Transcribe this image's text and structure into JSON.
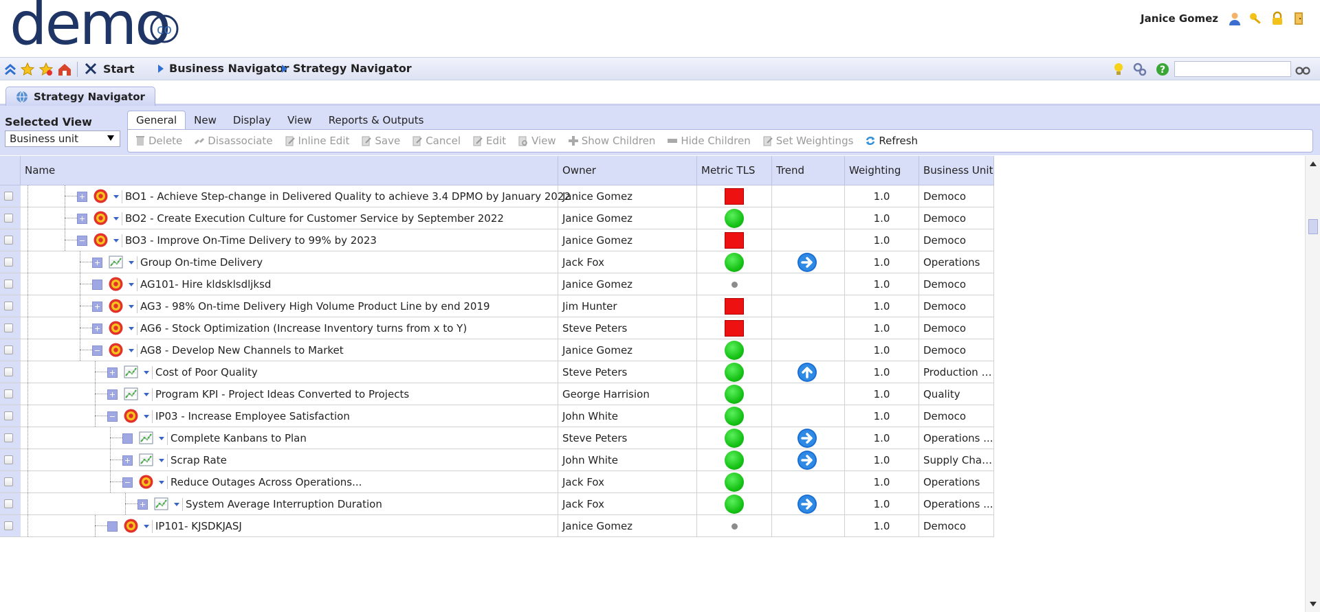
{
  "header": {
    "logo_text": "demo",
    "logo_badge": "co",
    "user_name": "Janice Gomez"
  },
  "nav": {
    "crumbs": [
      "Start",
      "Business Navigator",
      "Strategy Navigator"
    ],
    "search_value": ""
  },
  "tab": {
    "title": "Strategy Navigator"
  },
  "panel": {
    "selected_view_label": "Selected View",
    "selected_view_value": "Business unit",
    "tabs": [
      "General",
      "New",
      "Display",
      "View",
      "Reports & Outputs"
    ],
    "actions": [
      {
        "label": "Delete",
        "icon": "delete-icon",
        "enabled": false
      },
      {
        "label": "Disassociate",
        "icon": "disassociate-icon",
        "enabled": false
      },
      {
        "label": "Inline Edit",
        "icon": "inline-edit-icon",
        "enabled": false
      },
      {
        "label": "Save",
        "icon": "save-icon",
        "enabled": false
      },
      {
        "label": "Cancel",
        "icon": "cancel-icon",
        "enabled": false
      },
      {
        "label": "Edit",
        "icon": "edit-icon",
        "enabled": false
      },
      {
        "label": "View",
        "icon": "view-icon",
        "enabled": false
      },
      {
        "label": "Show Children",
        "icon": "show-children-icon",
        "enabled": false
      },
      {
        "label": "Hide Children",
        "icon": "hide-children-icon",
        "enabled": false
      },
      {
        "label": "Set Weightings",
        "icon": "set-weightings-icon",
        "enabled": false
      },
      {
        "label": "Refresh",
        "icon": "refresh-icon",
        "enabled": true
      }
    ]
  },
  "grid": {
    "columns": [
      "Name",
      "Owner",
      "Metric TLS",
      "Trend",
      "Weighting",
      "Business Unit"
    ],
    "rows": [
      {
        "depth": 0,
        "expander": "plus",
        "icon": "target-icon",
        "name": "BO1 - Achieve Step-change in Delivered Quality to achieve 3.4 DPMO by January 2022",
        "owner": "Janice Gomez",
        "tls": "red-square",
        "trend": "",
        "weighting": "1.0",
        "unit": "Democo"
      },
      {
        "depth": 0,
        "expander": "plus",
        "icon": "target-icon",
        "name": "BO2 - Create Execution Culture for Customer Service by September 2022",
        "owner": "Janice Gomez",
        "tls": "green-circle",
        "trend": "",
        "weighting": "1.0",
        "unit": "Democo"
      },
      {
        "depth": 0,
        "expander": "minus",
        "icon": "target-icon",
        "name": "BO3 - Improve On-Time Delivery to 99% by 2023",
        "owner": "Janice Gomez",
        "tls": "red-square",
        "trend": "",
        "weighting": "1.0",
        "unit": "Democo"
      },
      {
        "depth": 1,
        "expander": "plus",
        "icon": "chart-icon",
        "name": "Group On-time Delivery",
        "owner": "Jack Fox",
        "tls": "green-circle",
        "trend": "right",
        "weighting": "1.0",
        "unit": "Operations"
      },
      {
        "depth": 1,
        "expander": "leaf",
        "icon": "target-icon",
        "name": "AG101- Hire kldsklsdljksd",
        "owner": "Janice Gomez",
        "tls": "grey-dot",
        "trend": "",
        "weighting": "1.0",
        "unit": "Democo"
      },
      {
        "depth": 1,
        "expander": "plus",
        "icon": "target-icon",
        "name": "AG3 - 98% On-time Delivery High Volume Product Line by end 2019",
        "owner": "Jim Hunter",
        "tls": "red-square",
        "trend": "",
        "weighting": "1.0",
        "unit": "Democo"
      },
      {
        "depth": 1,
        "expander": "plus",
        "icon": "target-icon",
        "name": "AG6 - Stock Optimization (Increase Inventory turns from x to Y)",
        "owner": "Steve Peters",
        "tls": "red-square",
        "trend": "",
        "weighting": "1.0",
        "unit": "Democo"
      },
      {
        "depth": 1,
        "expander": "minus",
        "icon": "target-icon",
        "name": "AG8 - Develop New Channels to Market",
        "owner": "Janice Gomez",
        "tls": "green-circle",
        "trend": "",
        "weighting": "1.0",
        "unit": "Democo"
      },
      {
        "depth": 2,
        "expander": "plus",
        "icon": "chart-icon",
        "name": "Cost of Poor Quality",
        "owner": "Steve Peters",
        "tls": "green-circle",
        "trend": "up",
        "weighting": "1.0",
        "unit": "Production S..."
      },
      {
        "depth": 2,
        "expander": "plus",
        "icon": "chart-icon",
        "name": "Program KPI - Project Ideas Converted to Projects",
        "owner": "George Harrision",
        "tls": "green-circle",
        "trend": "",
        "weighting": "1.0",
        "unit": "Quality"
      },
      {
        "depth": 2,
        "expander": "minus",
        "icon": "target-icon",
        "name": "IP03 - Increase Employee Satisfaction",
        "owner": "John White",
        "tls": "green-circle",
        "trend": "",
        "weighting": "1.0",
        "unit": "Democo"
      },
      {
        "depth": 3,
        "expander": "leaf",
        "icon": "chart-icon",
        "name": "Complete Kanbans to Plan",
        "owner": "Steve Peters",
        "tls": "green-circle",
        "trend": "right",
        "weighting": "1.0",
        "unit": "Operations ..."
      },
      {
        "depth": 3,
        "expander": "plus",
        "icon": "chart-icon",
        "name": "Scrap Rate",
        "owner": "John White",
        "tls": "green-circle",
        "trend": "right",
        "weighting": "1.0",
        "unit": "Supply Chai..."
      },
      {
        "depth": 3,
        "expander": "minus",
        "icon": "target-icon",
        "name": "Reduce Outages Across Operations...",
        "owner": "Jack Fox",
        "tls": "green-circle",
        "trend": "",
        "weighting": "1.0",
        "unit": "Operations"
      },
      {
        "depth": 4,
        "expander": "plus",
        "icon": "chart-icon",
        "name": "System Average Interruption Duration",
        "owner": "Jack Fox",
        "tls": "green-circle",
        "trend": "right",
        "weighting": "1.0",
        "unit": "Operations ..."
      },
      {
        "depth": 2,
        "expander": "leaf",
        "icon": "target-icon",
        "name": "IP101- KJSDKJASJ",
        "owner": "Janice Gomez",
        "tls": "grey-dot",
        "trend": "",
        "weighting": "1.0",
        "unit": "Democo"
      }
    ]
  },
  "colors": {
    "accent": "#2f6fd0",
    "panel": "#d9def8",
    "logo": "#1e3566",
    "status_red": "#ee1111",
    "status_green": "#17c217"
  }
}
